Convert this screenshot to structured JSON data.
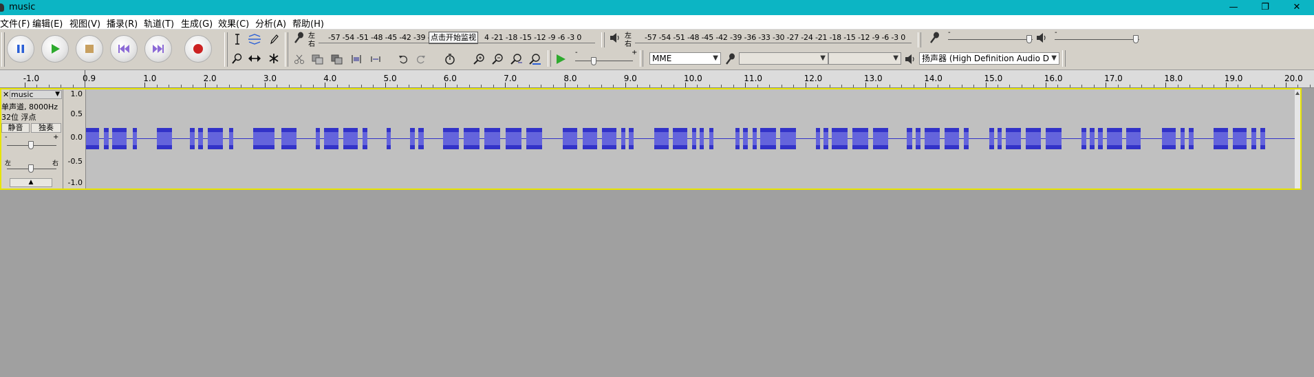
{
  "window": {
    "title": "music",
    "minimize_glyph": "—",
    "restore_glyph": "❐",
    "close_glyph": "✕"
  },
  "menu": [
    {
      "label": "文件(F)"
    },
    {
      "label": "编辑(E)"
    },
    {
      "label": "视图(V)"
    },
    {
      "label": "播录(R)"
    },
    {
      "label": "轨道(T)"
    },
    {
      "label": "生成(G)"
    },
    {
      "label": "效果(C)"
    },
    {
      "label": "分析(A)"
    },
    {
      "label": "帮助(H)"
    }
  ],
  "toolbar": {
    "record_meter": {
      "lr_label_top": "左",
      "lr_label_bottom": "右",
      "scale": "-57 -54 -51 -48 -45 -42 -39 -3",
      "monitor_label": "点击开始监视",
      "scale_tail": "4 -21 -18 -15 -12  -9  -6  -3  0"
    },
    "play_meter": {
      "lr_label_top": "左",
      "lr_label_bottom": "右",
      "scale": "-57 -54 -51 -48 -45 -42 -39 -36 -33 -30 -27 -24 -21 -18 -15 -12  -9  -6  -3  0"
    },
    "host": "MME",
    "recording_device": "",
    "recording_channels": "",
    "playback_device": "扬声器 (High Definition Audio D",
    "colors": {
      "title_bar": "#0cb5c4",
      "record_button": "#cc2222",
      "play_green": "#2eaa2e",
      "pause_blue": "#2a5fd6",
      "skip_purple": "#8c6ad6",
      "stop_tan": "#c8a060"
    },
    "icons": [
      "pause-icon",
      "play-icon",
      "stop-icon",
      "skip-start-icon",
      "skip-end-icon",
      "record-icon",
      "selection-tool-icon",
      "envelope-tool-icon",
      "draw-tool-icon",
      "zoom-tool-icon",
      "timeshift-tool-icon",
      "multi-tool-icon",
      "record-meter-mic-icon",
      "play-meter-speaker-icon",
      "cut-icon",
      "copy-icon",
      "paste-icon",
      "trim-icon",
      "silence-icon",
      "undo-icon",
      "redo-icon",
      "timer-icon",
      "zoom-in-icon",
      "zoom-out-icon",
      "fit-selection-icon",
      "fit-project-icon",
      "play-at-speed-icon",
      "mic-icon",
      "speaker-icon"
    ]
  },
  "mixer": {
    "input_minus": "-",
    "input_plus": "+",
    "output_minus": "-",
    "output_plus": "+",
    "input_level": 0.96,
    "output_level": 0.96,
    "play_speed_minus": "-",
    "play_speed_plus": "+"
  },
  "timeline": {
    "ticks": [
      "-1.0",
      "0.0",
      "1.0",
      "2.0",
      "3.0",
      "4.0",
      "5.0",
      "6.0",
      "7.0",
      "8.0",
      "9.0",
      "10.0",
      "11.0",
      "12.0",
      "13.0",
      "14.0",
      "15.0",
      "16.0",
      "17.0",
      "18.0",
      "19.0",
      "20.0"
    ],
    "start": -1.35,
    "seconds_per_tick": 1.0,
    "playhead_label": "0.9"
  },
  "track": {
    "name": "music",
    "info_line1": "单声道, 8000Hz",
    "info_line2": "32位 浮点",
    "mute_label": "静音",
    "solo_label": "独奏",
    "gain_minus": "-",
    "gain_plus": "+",
    "pan_left": "左",
    "pan_right": "右",
    "close_glyph": "✕",
    "menu_glyph": "▼",
    "collapse_glyph": "▲",
    "vruler": [
      "1.0",
      "0.5",
      "0.0",
      "-0.5",
      "-1.0"
    ],
    "waveform_color": "#3232c8",
    "waveform_rms_color": "#6464dc",
    "bursts_seconds": [
      [
        0.0,
        0.22
      ],
      [
        0.3,
        0.38
      ],
      [
        0.44,
        0.68
      ],
      [
        0.78,
        0.85
      ],
      [
        1.18,
        1.43
      ],
      [
        1.73,
        1.81
      ],
      [
        1.87,
        1.95
      ],
      [
        2.03,
        2.28
      ],
      [
        2.38,
        2.45
      ],
      [
        2.78,
        3.14
      ],
      [
        3.25,
        3.51
      ],
      [
        3.83,
        3.9
      ],
      [
        3.96,
        4.2
      ],
      [
        4.28,
        4.52
      ],
      [
        4.61,
        4.69
      ],
      [
        5.01,
        5.08
      ],
      [
        5.4,
        5.47
      ],
      [
        5.53,
        5.63
      ],
      [
        5.95,
        6.21
      ],
      [
        6.29,
        6.55
      ],
      [
        6.63,
        6.9
      ],
      [
        6.99,
        7.25
      ],
      [
        7.33,
        7.59
      ],
      [
        7.94,
        8.18
      ],
      [
        8.27,
        8.51
      ],
      [
        8.59,
        8.83
      ],
      [
        8.91,
        8.98
      ],
      [
        9.04,
        9.12
      ],
      [
        9.46,
        9.7
      ],
      [
        9.77,
        10.01
      ],
      [
        10.09,
        10.16
      ],
      [
        10.22,
        10.29
      ],
      [
        10.38,
        10.45
      ],
      [
        10.81,
        10.88
      ],
      [
        10.94,
        11.02
      ],
      [
        11.1,
        11.17
      ],
      [
        11.23,
        11.49
      ],
      [
        11.56,
        11.82
      ],
      [
        12.15,
        12.22
      ],
      [
        12.28,
        12.36
      ],
      [
        12.42,
        12.68
      ],
      [
        12.76,
        13.02
      ],
      [
        13.1,
        13.36
      ],
      [
        13.67,
        13.76
      ],
      [
        13.82,
        13.89
      ],
      [
        13.96,
        14.22
      ],
      [
        14.3,
        14.54
      ],
      [
        14.62,
        14.7
      ],
      [
        15.04,
        15.12
      ],
      [
        15.18,
        15.25
      ],
      [
        15.32,
        15.57
      ],
      [
        15.65,
        15.9
      ],
      [
        15.98,
        16.24
      ],
      [
        16.57,
        16.65
      ],
      [
        16.71,
        16.79
      ],
      [
        16.85,
        16.93
      ],
      [
        17.0,
        17.25
      ],
      [
        17.32,
        17.56
      ],
      [
        17.92,
        18.15
      ],
      [
        18.22,
        18.29
      ],
      [
        18.36,
        18.44
      ],
      [
        18.78,
        19.02
      ],
      [
        19.09,
        19.33
      ],
      [
        19.41,
        19.49
      ],
      [
        19.55,
        19.63
      ]
    ]
  }
}
